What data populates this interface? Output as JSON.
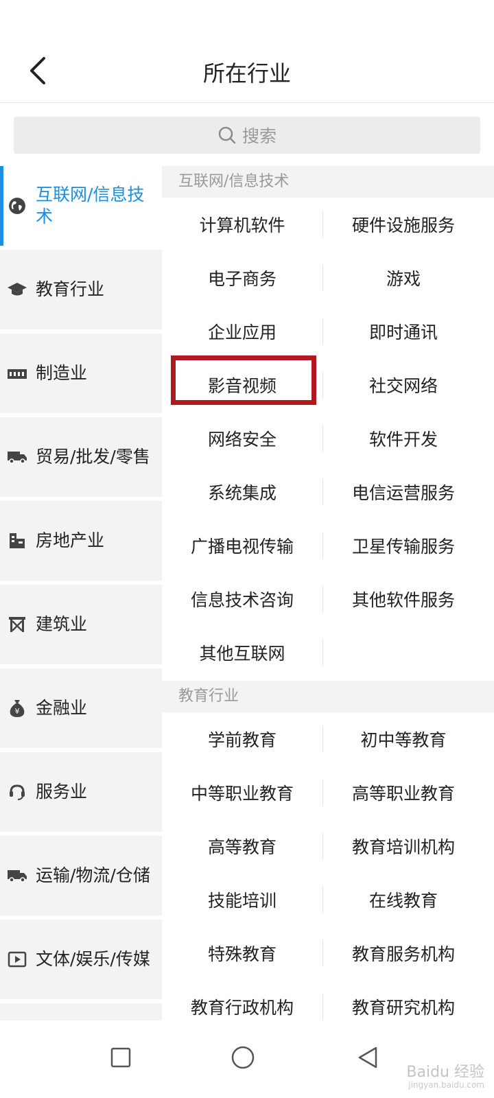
{
  "header": {
    "title": "所在行业"
  },
  "search": {
    "placeholder": "搜索"
  },
  "sidebar": {
    "active_index": 0,
    "items": [
      {
        "label": "互联网/信息技术",
        "icon": "globe-icon"
      },
      {
        "label": "教育行业",
        "icon": "graduation-cap-icon"
      },
      {
        "label": "制造业",
        "icon": "factory-icon"
      },
      {
        "label": "贸易/批发/零售",
        "icon": "truck-icon"
      },
      {
        "label": "房地产业",
        "icon": "building-icon"
      },
      {
        "label": "建筑业",
        "icon": "construction-icon"
      },
      {
        "label": "金融业",
        "icon": "money-bag-icon"
      },
      {
        "label": "服务业",
        "icon": "service-icon"
      },
      {
        "label": "运输/物流/仓储",
        "icon": "truck-icon"
      },
      {
        "label": "文体/娱乐/传媒",
        "icon": "video-play-icon"
      }
    ]
  },
  "sections": [
    {
      "header": "互联网/信息技术",
      "items": [
        "计算机软件",
        "硬件设施服务",
        "电子商务",
        "游戏",
        "企业应用",
        "即时通讯",
        "影音视频",
        "社交网络",
        "网络安全",
        "软件开发",
        "系统集成",
        "电信运营服务",
        "广播电视传输",
        "卫星传输服务",
        "信息技术咨询",
        "其他软件服务",
        "其他互联网"
      ]
    },
    {
      "header": "教育行业",
      "items": [
        "学前教育",
        "初中等教育",
        "中等职业教育",
        "高等职业教育",
        "高等教育",
        "教育培训机构",
        "技能培训",
        "在线教育",
        "特殊教育",
        "教育服务机构",
        "教育行政机构",
        "教育研究机构"
      ]
    }
  ],
  "highlighted_item": "影音视频",
  "watermark": {
    "line1": "Baidu 经验",
    "line2": "jingyan.baidu.com"
  },
  "colors": {
    "accent": "#1a8fe3",
    "highlight": "#b0191e",
    "sidebar_bg": "#f3f3f5"
  }
}
